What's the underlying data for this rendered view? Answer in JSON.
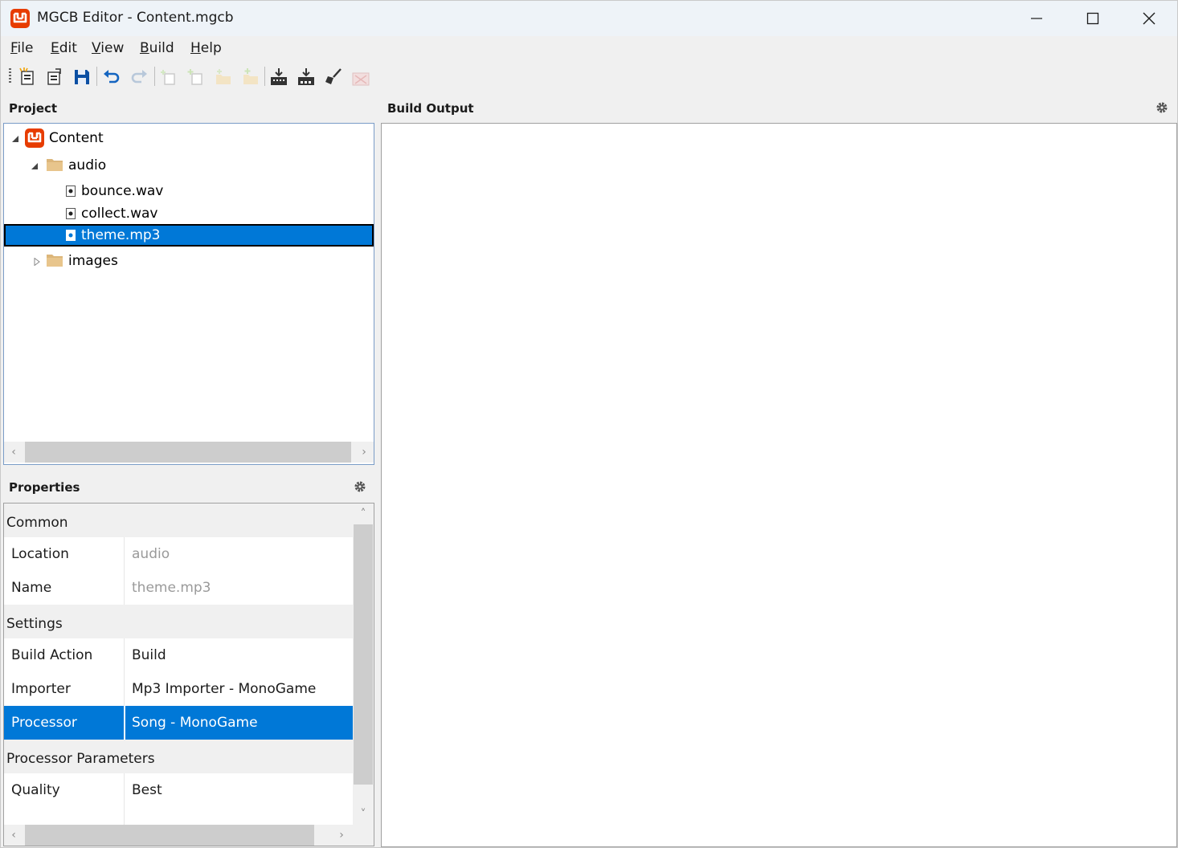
{
  "window": {
    "title": "MGCB Editor - Content.mgcb"
  },
  "menu": {
    "items": [
      {
        "label": "File",
        "mnemonic": "F",
        "rest": "ile"
      },
      {
        "label": "Edit",
        "mnemonic": "E",
        "rest": "dit"
      },
      {
        "label": "View",
        "mnemonic": "V",
        "rest": "iew"
      },
      {
        "label": "Build",
        "mnemonic": "B",
        "rest": "uild"
      },
      {
        "label": "Help",
        "mnemonic": "H",
        "rest": "elp"
      }
    ]
  },
  "toolbar": {
    "buttons": [
      "new-project-icon",
      "open-project-icon",
      "save-icon",
      "undo-icon",
      "redo-icon",
      "new-item-icon",
      "add-existing-item-icon",
      "new-folder-icon",
      "add-existing-folder-icon",
      "build-icon",
      "rebuild-icon",
      "clean-icon",
      "cancel-build-icon"
    ]
  },
  "project": {
    "title": "Project",
    "tree": [
      {
        "label": "Content",
        "level": 0,
        "icon": "monogame-icon",
        "expanded": true
      },
      {
        "label": "audio",
        "level": 1,
        "icon": "folder-icon",
        "expanded": true
      },
      {
        "label": "bounce.wav",
        "level": 2,
        "icon": "audio-file-icon"
      },
      {
        "label": "collect.wav",
        "level": 2,
        "icon": "audio-file-icon"
      },
      {
        "label": "theme.mp3",
        "level": 2,
        "icon": "audio-file-icon",
        "selected": true
      },
      {
        "label": "images",
        "level": 1,
        "icon": "folder-icon",
        "expanded": false
      }
    ]
  },
  "build_output": {
    "title": "Build Output"
  },
  "properties": {
    "title": "Properties",
    "categories": [
      {
        "name": "Common",
        "rows": [
          {
            "name": "Location",
            "value": "audio",
            "readonly": true
          },
          {
            "name": "Name",
            "value": "theme.mp3",
            "readonly": true
          }
        ]
      },
      {
        "name": "Settings",
        "rows": [
          {
            "name": "Build Action",
            "value": "Build"
          },
          {
            "name": "Importer",
            "value": "Mp3 Importer - MonoGame"
          },
          {
            "name": "Processor",
            "value": "Song - MonoGame",
            "selected": true
          }
        ]
      },
      {
        "name": "Processor Parameters",
        "rows": [
          {
            "name": "Quality",
            "value": "Best"
          }
        ]
      }
    ]
  },
  "colors": {
    "selection": "#0078d7",
    "brand": "#e73c00"
  }
}
